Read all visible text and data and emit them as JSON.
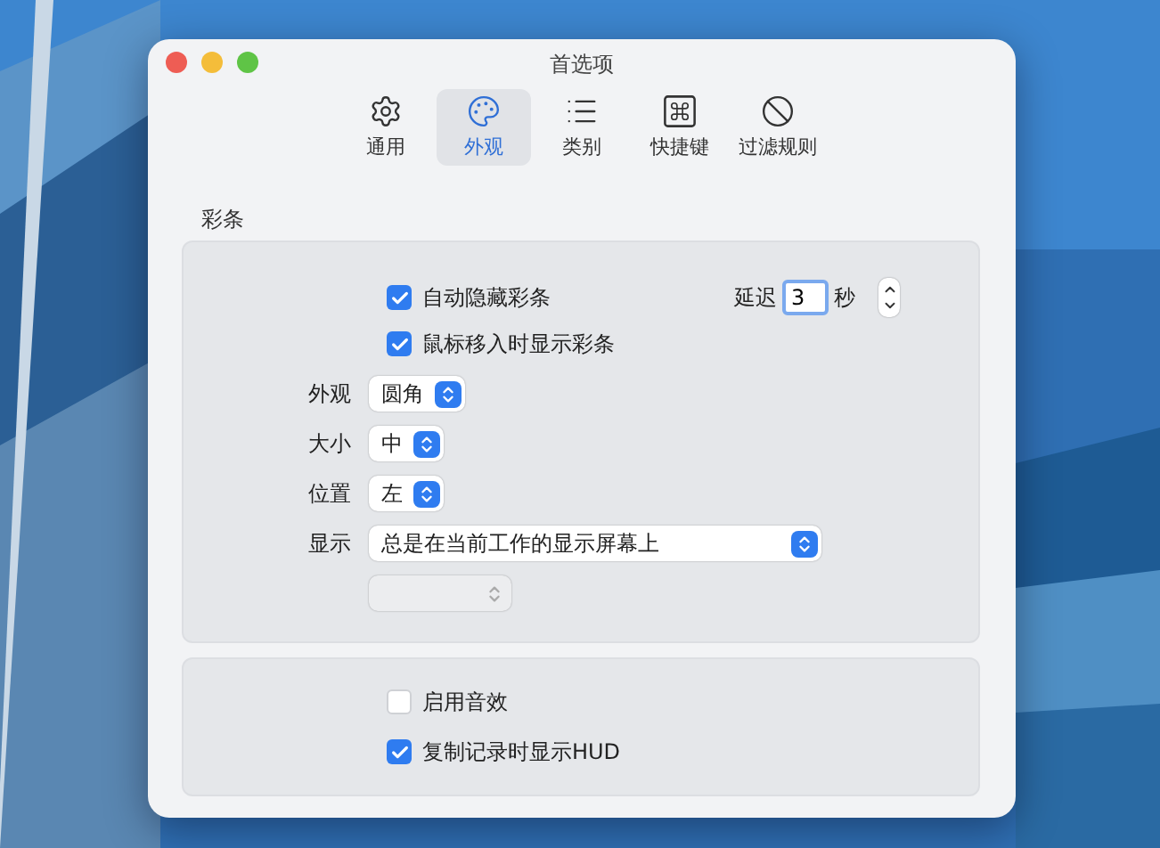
{
  "window": {
    "title": "首选项"
  },
  "tabs": [
    {
      "label": "通用",
      "selected": false
    },
    {
      "label": "外观",
      "selected": true
    },
    {
      "label": "类别",
      "selected": false
    },
    {
      "label": "快捷键",
      "selected": false
    },
    {
      "label": "过滤规则",
      "selected": false
    }
  ],
  "section_title": "彩条",
  "bar_panel": {
    "checkboxes": [
      {
        "label": "自动隐藏彩条",
        "checked": true
      },
      {
        "label": "鼠标移入时显示彩条",
        "checked": true
      }
    ],
    "delay": {
      "label": "延迟",
      "value": "3",
      "unit": "秒"
    },
    "popups": [
      {
        "label": "外观",
        "value": "圆角"
      },
      {
        "label": "大小",
        "value": "中"
      },
      {
        "label": "位置",
        "value": "左"
      },
      {
        "label": "显示",
        "value": "总是在当前工作的显示屏幕上"
      }
    ],
    "extra_popup": {
      "disabled": true
    }
  },
  "sound_panel": {
    "checkboxes": [
      {
        "label": "启用音效",
        "checked": false
      },
      {
        "label": "复制记录时显示HUD",
        "checked": true
      }
    ]
  }
}
